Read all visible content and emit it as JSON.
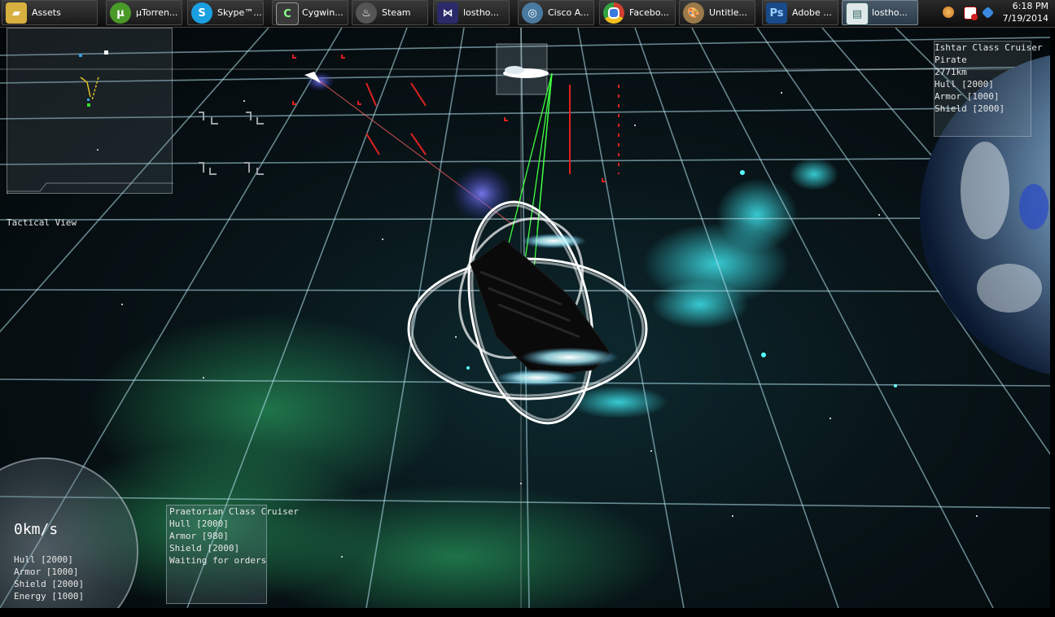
{
  "taskbar": {
    "items": [
      {
        "label": "Assets",
        "icon": "folder-icon",
        "color": "#d8b040"
      },
      {
        "label": "µTorren...",
        "icon": "utorrent-icon",
        "color": "#4a9a2a"
      },
      {
        "label": "Skype™...",
        "icon": "skype-icon",
        "color": "#1aa0e0"
      },
      {
        "label": "Cygwin...",
        "icon": "terminal-icon",
        "color": "#3a3a3a"
      },
      {
        "label": "Steam",
        "icon": "steam-icon",
        "color": "#555555"
      },
      {
        "label": "lostho...",
        "icon": "visual-studio-icon",
        "color": "#2a2a6a"
      },
      {
        "label": "Cisco A...",
        "icon": "cisco-icon",
        "color": "#4a7aa0"
      },
      {
        "label": "Facebo...",
        "icon": "chrome-icon",
        "color": "#d04030"
      },
      {
        "label": "Untitle...",
        "icon": "paint-icon",
        "color": "#9a7a4a"
      },
      {
        "label": "Adobe ...",
        "icon": "photoshop-icon",
        "color": "#1a4a8a"
      },
      {
        "label": "lostho...",
        "icon": "game-window-icon",
        "color": "#3a6a6a"
      }
    ],
    "clock": {
      "time": "6:18 PM",
      "date": "7/19/2014"
    }
  },
  "hud": {
    "tactical_label": "Tactical View",
    "target": {
      "name": "Ishtar Class Cruiser",
      "faction": "Pirate",
      "distance": "2771km",
      "hull": "Hull [2000]",
      "armor": "Armor [1000]",
      "shield": "Shield [2000]"
    },
    "self": {
      "name": "Praetorian Class Cruiser",
      "hull": "Hull [2000]",
      "armor": "Armor [980]",
      "shield": "Shield [2000]",
      "status": "Waiting for orders"
    },
    "gauge": {
      "speed": "0km/s",
      "hull": "Hull [2000]",
      "armor": "Armor [1000]",
      "shield": "Shield [2000]",
      "energy": "Energy [1000]"
    }
  },
  "colors": {
    "grid": "#9ad8e8",
    "laser_green": "#40ff40",
    "laser_red": "#ff6060",
    "marker_red": "#e02020",
    "nebula": "#40e0e8"
  }
}
